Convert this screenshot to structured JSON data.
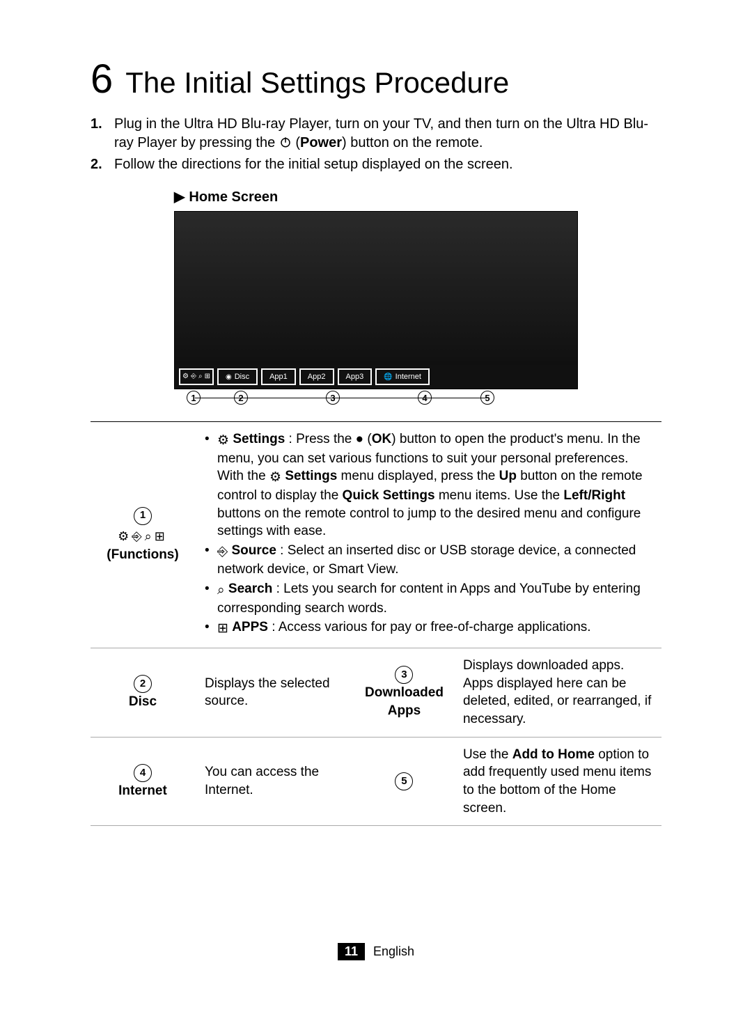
{
  "section": {
    "number": "6",
    "title": "The Initial Settings Procedure"
  },
  "instructions": [
    {
      "n": "1.",
      "pre": "Plug in the Ultra HD Blu-ray Player, turn on your TV, and then turn on the Ultra HD Blu-ray Player by pressing the ",
      "btn": "Power",
      "post": ") button on the remote."
    },
    {
      "n": "2.",
      "pre": "Follow the directions for the initial setup displayed on the screen.",
      "btn": "",
      "post": ""
    }
  ],
  "home_screen_label": "Home Screen",
  "taskbar": {
    "disc": "Disc",
    "apps": [
      "App1",
      "App2",
      "App3"
    ],
    "internet": "Internet"
  },
  "callouts": [
    "1",
    "2",
    "3",
    "4",
    "5"
  ],
  "row1": {
    "label": "(Functions)",
    "settings": {
      "name": "Settings",
      "pre": " : Press the ",
      "ok": "OK",
      "mid1": ") button to open the product's menu. In the menu, you can set various functions to suit your personal preferences. With the ",
      "name2": "Settings",
      "mid2": " menu displayed, press the ",
      "up": "Up",
      "mid3": " button on the remote control to display the ",
      "qs": "Quick Settings",
      "mid4": " menu items. Use the ",
      "lr": "Left/Right",
      "tail": " buttons on the remote control to jump to the desired menu and configure settings with ease."
    },
    "source": {
      "name": "Source",
      "text": " : Select an inserted disc or USB storage device, a connected network device, or Smart View."
    },
    "search": {
      "name": "Search",
      "text": " : Lets you search for content in Apps and YouTube by entering corresponding search words."
    },
    "apps": {
      "name": "APPS",
      "text": " : Access various for pay or free-of-charge applications."
    }
  },
  "row2": {
    "disc_label": "Disc",
    "disc_text": "Displays the selected source.",
    "dn_label": "Downloaded Apps",
    "dn_text": "Displays downloaded apps. Apps displayed here can be deleted, edited, or rearranged, if necessary."
  },
  "row3": {
    "int_label": "Internet",
    "int_text": "You can access the Internet.",
    "add_pre": "Use the ",
    "add_bold": "Add to Home",
    "add_post": " option to add frequently used menu items to the bottom of the Home screen."
  },
  "footer": {
    "page": "11",
    "lang": "English"
  }
}
